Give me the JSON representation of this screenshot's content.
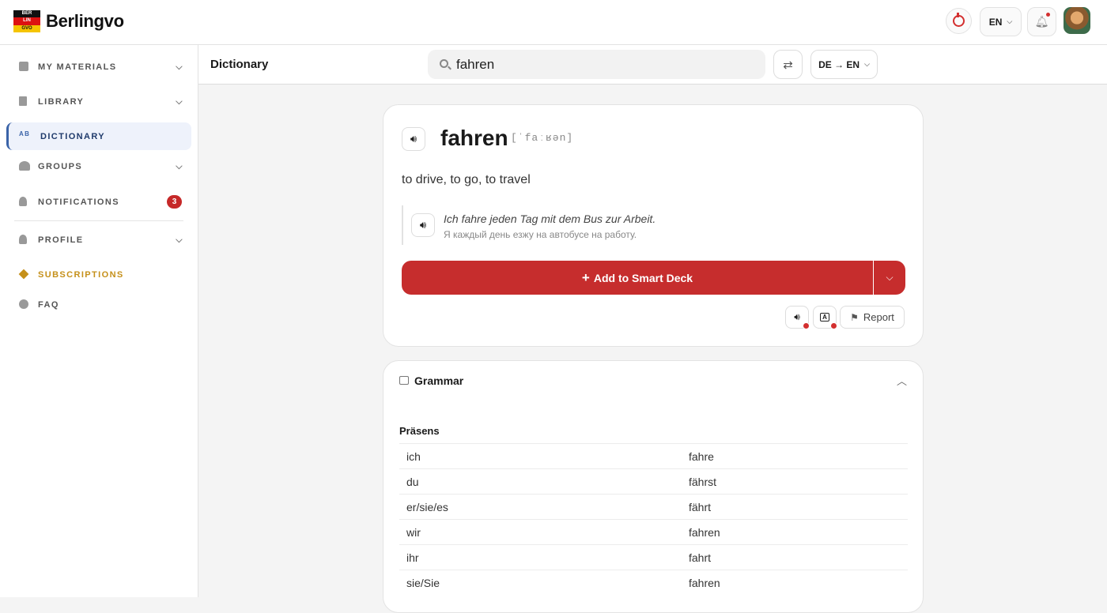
{
  "app": {
    "brand": "Berlingvo",
    "flag": [
      "BER",
      "LIN",
      "GVO"
    ]
  },
  "topbar": {
    "lang": "EN"
  },
  "sidebar": {
    "items": [
      {
        "label": "MY MATERIALS"
      },
      {
        "label": "LIBRARY"
      },
      {
        "label": "DICTIONARY"
      },
      {
        "label": "GROUPS"
      },
      {
        "label": "NOTIFICATIONS",
        "badge": "3"
      },
      {
        "label": "PROFILE"
      },
      {
        "label": "SUBSCRIPTIONS"
      },
      {
        "label": "FAQ"
      }
    ]
  },
  "header": {
    "title": "Dictionary",
    "search_value": "fahren",
    "pair": "DE → EN"
  },
  "entry": {
    "word": "fahren",
    "ipa": "[ˈfaːʁən]",
    "translation": "to drive, to go, to travel",
    "example_de": "Ich fahre jeden Tag mit dem Bus zur Arbeit.",
    "example_ru": "Я каждый день езжу на автобусе на работу.",
    "add_label": "Add to Smart Deck",
    "report_label": "Report"
  },
  "grammar": {
    "title": "Grammar",
    "tense": "Präsens",
    "rows": [
      {
        "p": "ich",
        "f": "fahre"
      },
      {
        "p": "du",
        "f": "fährst"
      },
      {
        "p": "er/sie/es",
        "f": "fährt"
      },
      {
        "p": "wir",
        "f": "fahren"
      },
      {
        "p": "ihr",
        "f": "fahrt"
      },
      {
        "p": "sie/Sie",
        "f": "fahren"
      }
    ]
  },
  "colors": {
    "accent": "#c62d2d",
    "active_nav": "#3a63a8",
    "gold": "#c5901a"
  }
}
